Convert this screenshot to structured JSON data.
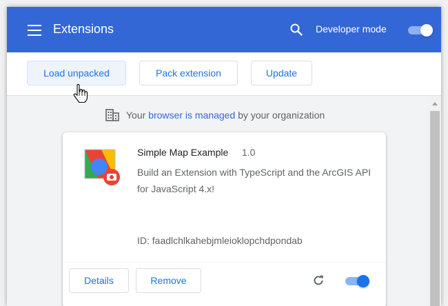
{
  "header": {
    "title": "Extensions",
    "developer_mode_label": "Developer mode",
    "developer_mode_enabled": true
  },
  "toolbar": {
    "load_unpacked_label": "Load unpacked",
    "pack_extension_label": "Pack extension",
    "update_label": "Update"
  },
  "managed_notice": {
    "prefix": "Your",
    "link": "browser is managed",
    "suffix": "by your organization"
  },
  "extension": {
    "name": "Simple Map Example",
    "version": "1.0",
    "description": "Build an Extension with TypeScript and the ArcGIS API for JavaScript 4.x!",
    "id_text": "ID: faadlchlkahebjmleioklopchdpondab",
    "details_label": "Details",
    "remove_label": "Remove",
    "enabled": true
  },
  "colors": {
    "header_bg": "#3367d6",
    "accent": "#1a73e8",
    "page_bg": "#f1f3f4"
  }
}
